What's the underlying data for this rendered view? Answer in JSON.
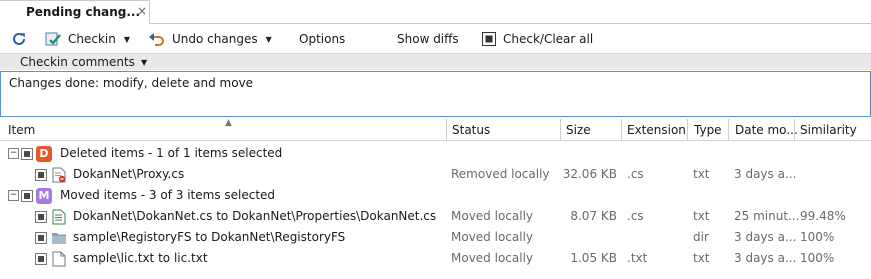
{
  "tab": {
    "title": "Pending chang...",
    "close": "×"
  },
  "toolbar": {
    "checkin": "Checkin",
    "undo": "Undo changes",
    "options": "Options",
    "show_diffs": "Show diffs",
    "check_clear": "Check/Clear all",
    "colors": {
      "refresh": "#2b5fa8",
      "checkin": "#1a8f5a",
      "undo": "#c87a1a"
    }
  },
  "comments": {
    "header": "Checkin comments",
    "text": "Changes done: modify, delete and move"
  },
  "columns": [
    "Item",
    "Status",
    "Size",
    "Extension",
    "Type",
    "Date mo...",
    "Similarity"
  ],
  "groups": [
    {
      "badge": "D",
      "badge_color": "#e4582b",
      "label": "Deleted items - 1 of 1 items selected",
      "rows": [
        {
          "icon": "deleted-file-icon",
          "item": "DokanNet\\Proxy.cs",
          "status": "Removed locally",
          "size": "32.06 KB",
          "ext": ".cs",
          "type": "txt",
          "date": "3 days a...",
          "similarity": ""
        }
      ]
    },
    {
      "badge": "M",
      "badge_color": "#a57be0",
      "label": "Moved items - 3 of 3 items selected",
      "rows": [
        {
          "icon": "code-file-icon",
          "item": "DokanNet\\DokanNet.cs to DokanNet\\Properties\\DokanNet.cs",
          "status": "Moved locally",
          "size": "8.07 KB",
          "ext": ".cs",
          "type": "txt",
          "date": "25 minut...",
          "similarity": "99.48%"
        },
        {
          "icon": "folder-icon",
          "item": "sample\\RegistoryFS to DokanNet\\RegistoryFS",
          "status": "Moved locally",
          "size": "",
          "ext": "",
          "type": "dir",
          "date": "3 days a...",
          "similarity": "100%"
        },
        {
          "icon": "text-file-icon",
          "item": "sample\\lic.txt to lic.txt",
          "status": "Moved locally",
          "size": "1.05 KB",
          "ext": ".txt",
          "type": "txt",
          "date": "3 days a...",
          "similarity": "100%"
        }
      ]
    }
  ]
}
